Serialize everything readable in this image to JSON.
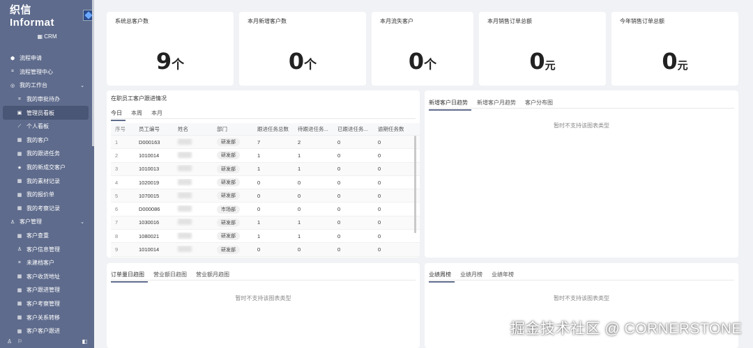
{
  "sidebar": {
    "logo_text": "织信 Informat",
    "app_label": "CRM",
    "items": [
      {
        "label": "流程申请",
        "icon": "cube-icon",
        "sub": false
      },
      {
        "label": "流程管理中心",
        "icon": "grid-icon",
        "sub": false
      },
      {
        "label": "我的工作台",
        "icon": "monitor-icon",
        "sub": false,
        "chevron": "⌄"
      },
      {
        "label": "我的审批待办",
        "icon": "grid-icon",
        "sub": true
      },
      {
        "label": "管理员看板",
        "icon": "chart-box-icon",
        "sub": true,
        "active": true
      },
      {
        "label": "个人看板",
        "icon": "line-chart-icon",
        "sub": true
      },
      {
        "label": "我的客户",
        "icon": "table-icon",
        "sub": true
      },
      {
        "label": "我的跟进任务",
        "icon": "table-icon",
        "sub": true
      },
      {
        "label": "我的新成交客户",
        "icon": "star-icon",
        "sub": true
      },
      {
        "label": "我的素材记录",
        "icon": "table-icon",
        "sub": true
      },
      {
        "label": "我的报价单",
        "icon": "table-icon",
        "sub": true
      },
      {
        "label": "我的考察记录",
        "icon": "table-icon",
        "sub": true
      },
      {
        "label": "客户管理",
        "icon": "user-icon",
        "sub": false,
        "chevron": "⌄"
      },
      {
        "label": "客户查重",
        "icon": "table-icon",
        "sub": true
      },
      {
        "label": "客户信息管理",
        "icon": "user-icon",
        "sub": true
      },
      {
        "label": "未建档客户",
        "icon": "grid-icon",
        "sub": true
      },
      {
        "label": "客户收货地址",
        "icon": "table-icon",
        "sub": true
      },
      {
        "label": "客户跟进管理",
        "icon": "table-icon",
        "sub": true
      },
      {
        "label": "客户考察管理",
        "icon": "table-icon",
        "sub": true
      },
      {
        "label": "客户关系转移",
        "icon": "table-icon",
        "sub": true
      },
      {
        "label": "客户客户跟进",
        "icon": "table-icon",
        "sub": true
      }
    ]
  },
  "stats": [
    {
      "title": "系统总客户数",
      "value": "9",
      "unit": "个"
    },
    {
      "title": "本月新增客户数",
      "value": "0",
      "unit": "个"
    },
    {
      "title": "本月流失客户",
      "value": "0",
      "unit": "个"
    },
    {
      "title": "本月销售订单总额",
      "value": "0",
      "unit": "元"
    },
    {
      "title": "今年销售订单总额",
      "value": "0",
      "unit": "元"
    }
  ],
  "followup_panel": {
    "title": "在职员工客户跟进情况",
    "tabs": [
      "今日",
      "本周",
      "本月"
    ],
    "columns": [
      "序号",
      "员工编号",
      "姓名",
      "部门",
      "跟进任务总数",
      "待跟进任务...",
      "已跟进任务...",
      "逾期任务数"
    ],
    "rows": [
      [
        "1",
        "D000163",
        "",
        "研发部",
        "7",
        "2",
        "0",
        "0"
      ],
      [
        "2",
        "1010014",
        "",
        "研发部",
        "1",
        "1",
        "0",
        "0"
      ],
      [
        "3",
        "1010013",
        "",
        "研发部",
        "1",
        "1",
        "0",
        "0"
      ],
      [
        "4",
        "1020019",
        "",
        "研发部",
        "0",
        "0",
        "0",
        "0"
      ],
      [
        "5",
        "1070015",
        "",
        "研发部",
        "0",
        "0",
        "0",
        "0"
      ],
      [
        "6",
        "D000086",
        "",
        "市场部",
        "0",
        "0",
        "0",
        "0"
      ],
      [
        "7",
        "1030016",
        "",
        "研发部",
        "1",
        "1",
        "0",
        "0"
      ],
      [
        "8",
        "1080021",
        "",
        "研发部",
        "1",
        "1",
        "0",
        "0"
      ],
      [
        "9",
        "1010014",
        "",
        "研发部",
        "0",
        "0",
        "0",
        "0"
      ]
    ]
  },
  "trend_panel": {
    "tabs": [
      "新增客户日趋势",
      "新增客户月趋势",
      "客户分布图"
    ],
    "empty_text": "暂时不支持该图表类型"
  },
  "order_panel": {
    "tabs": [
      "订单量日趋图",
      "营业额日趋图",
      "营业额月趋图"
    ],
    "empty_text": "暂时不支持该图表类型"
  },
  "rank_panel": {
    "tabs": [
      "业绩周榜",
      "业绩月榜",
      "业绩年榜"
    ],
    "empty_text": "暂时不支持该图表类型"
  },
  "watermark": "掘金技术社区 @ CORNERSTONE"
}
